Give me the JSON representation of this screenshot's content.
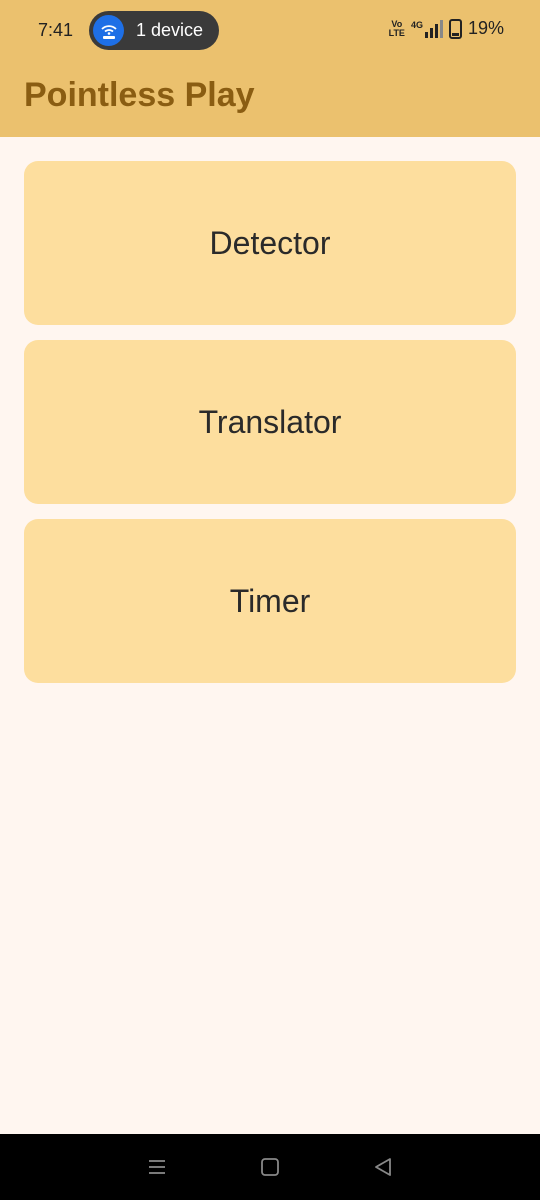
{
  "status_bar": {
    "time": "7:41",
    "hotspot_label": "1 device",
    "volte_top": "Vo",
    "volte_bottom": "LTE",
    "network_type": "4G",
    "battery_percent": "19%",
    "battery_level": 0.19
  },
  "app_bar": {
    "title": "Pointless Play",
    "background_color": "#ebc16e",
    "title_color": "#8a5d12"
  },
  "menu": {
    "items": [
      {
        "label": "Detector"
      },
      {
        "label": "Translator"
      },
      {
        "label": "Timer"
      }
    ],
    "card_color": "#fdde9e"
  },
  "nav_bar": {
    "icons": [
      "recents-icon",
      "home-icon",
      "back-icon"
    ]
  }
}
